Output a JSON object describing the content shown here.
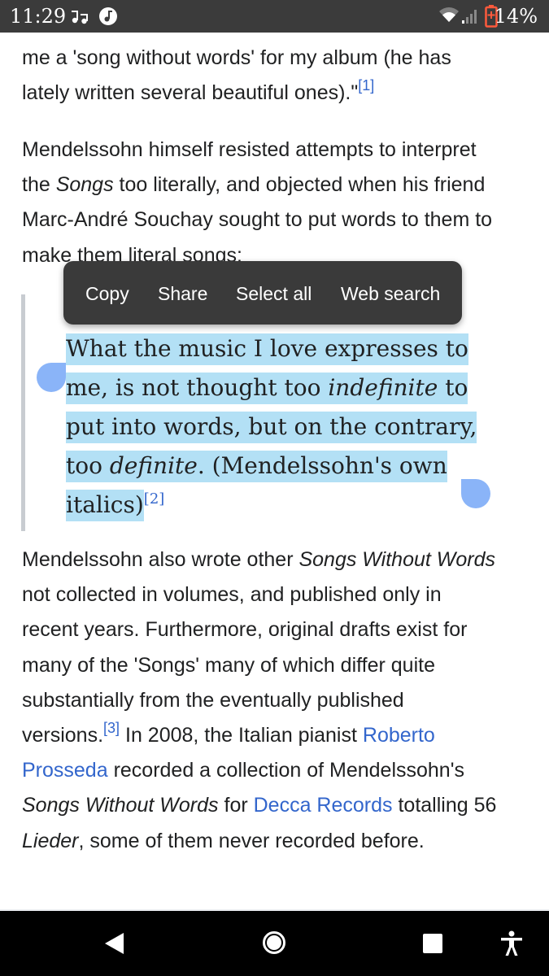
{
  "status_bar": {
    "time": "11:29",
    "notification_icons": [
      "music-shuffle-icon",
      "music-note-icon"
    ],
    "battery_percent": "14%",
    "colors": {
      "background": "#3b3b3b",
      "battery_low": "#ff5a3c"
    }
  },
  "article": {
    "intro_tail": {
      "line1": "me a 'song without words' for my album (he has",
      "line2": "lately written several beautiful ones).\"",
      "ref": "[1]"
    },
    "para1": {
      "line1": "Mendelssohn himself resisted attempts to interpret",
      "line2_pre": "the ",
      "line2_em": "Songs",
      "line2_post": " too literally, and objected when his friend",
      "line3": "Marc-André Souchay sought to put words to them to",
      "line4": "make them literal songs:"
    },
    "blockquote": {
      "part1": "What the music I love expresses to me, is not thought too ",
      "em1": "indefinite",
      "part2": " to put into words, but on the contrary, too ",
      "em2": "definite",
      "part3": ". (Mendelssohn's own italics)",
      "ref": "[2]"
    },
    "para2": {
      "line1_pre": "Mendelssohn also wrote other ",
      "line1_em": "Songs Without Words",
      "line2": "not collected in volumes, and published only in",
      "line3": "recent years. Furthermore, original drafts exist for",
      "line4": "many of the 'Songs' many of which differ quite",
      "line5": "substantially from the eventually published",
      "line6_pre": "versions.",
      "ref": "[3]",
      "line6_mid": " In 2008, the Italian pianist ",
      "link_roberto": "Roberto",
      "link_prosseda": "Prosseda",
      "line7_post": " recorded a collection of Mendelssohn's",
      "line8_em": "Songs Without Words",
      "line8_mid": " for ",
      "link_decca": "Decca Records",
      "line8_post": " totalling 56",
      "line9_em": "Lieder",
      "line9_post": ", some of them never recorded before."
    },
    "colors": {
      "text": "#202122",
      "link": "#3366cc",
      "selection": "#b3e0f5",
      "handle": "#8ab4f8"
    }
  },
  "selection_toolbar": {
    "copy": "Copy",
    "share": "Share",
    "select_all": "Select all",
    "web_search": "Web search"
  },
  "nav_bar": {
    "buttons": [
      "back-icon",
      "home-icon",
      "recents-icon",
      "accessibility-icon"
    ]
  }
}
